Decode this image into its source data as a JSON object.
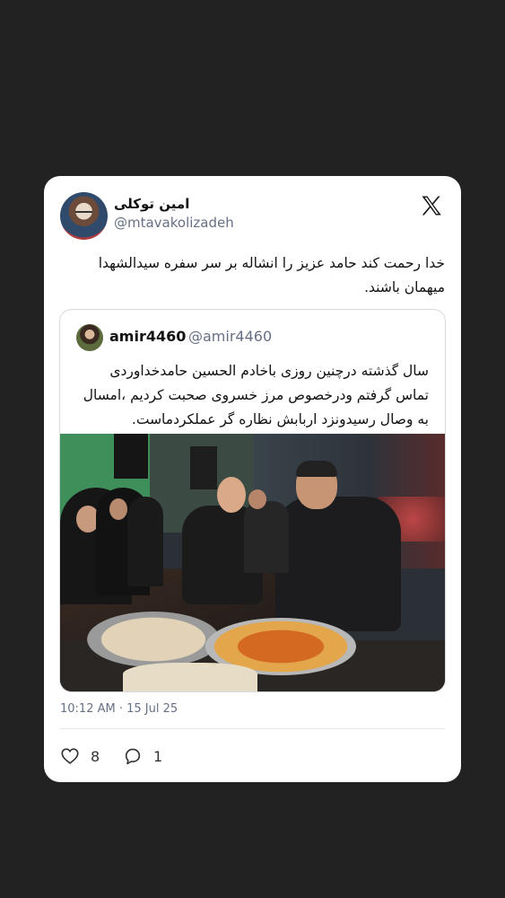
{
  "tweet": {
    "author_name": "امین توکلی",
    "author_handle": "@mtavakolizadeh",
    "text": "خدا رحمت کند حامد عزیز را انشاله بر سر سفره سیدالشهدا میهمان باشند.",
    "timestamp": "10:12 AM · 15 Jul 25",
    "likes": "8",
    "replies": "1"
  },
  "quote": {
    "author_name": "amir4460",
    "author_handle": "@amir4460",
    "text": "سال گذشته درچنین روزی باخادم الحسین حامدخداوردی تماس گرفتم ودرخصوص مرز خسروی صحبت کردیم ،امسال به وصال رسیدونزد اربابش نظاره گر عملکردماست."
  },
  "icons": {
    "logo": "x-logo-icon",
    "like": "heart-icon",
    "reply": "reply-bubble-icon"
  },
  "colors": {
    "page_background": "#222222",
    "card_background": "#ffffff",
    "secondary_text": "#667085"
  }
}
